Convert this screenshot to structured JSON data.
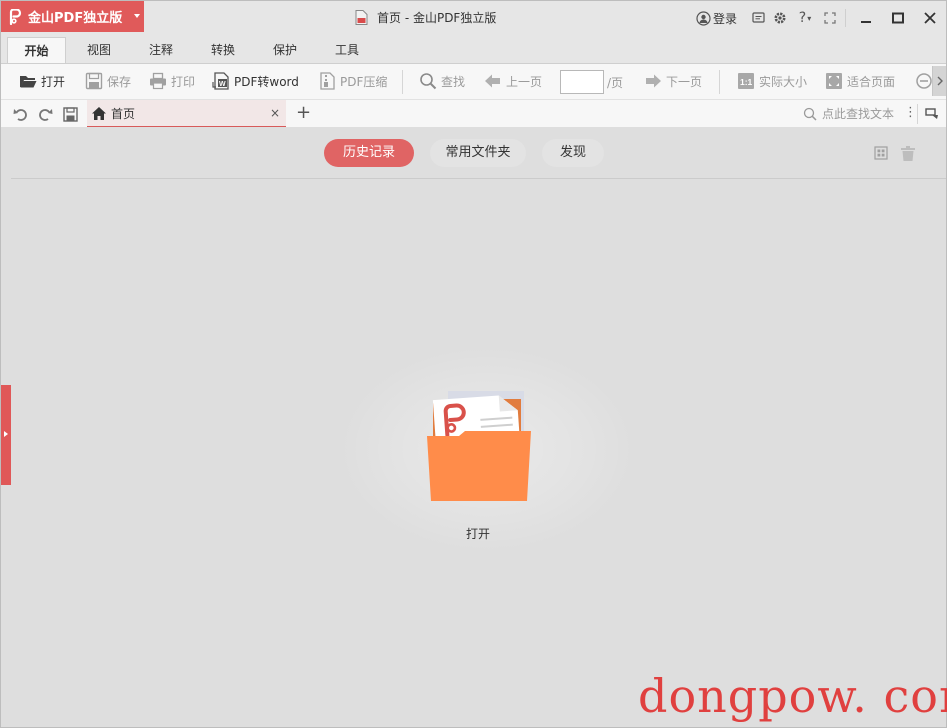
{
  "app": {
    "name": "金山PDF独立版",
    "window_title": "首页 - 金山PDF独立版",
    "brand_color": "#e05a5a"
  },
  "titlebar": {
    "login": "登录",
    "help": "?"
  },
  "ribbon_tabs": [
    "开始",
    "视图",
    "注释",
    "转换",
    "保护",
    "工具"
  ],
  "toolbar": {
    "open": "打开",
    "save": "保存",
    "print": "打印",
    "pdf_to_word": "PDF转word",
    "pdf_compress": "PDF压缩",
    "find": "查找",
    "prev_page": "上一页",
    "page_value": "",
    "page_suffix": "/页",
    "next_page": "下一页",
    "actual_size": "实际大小",
    "fit_page": "适合页面"
  },
  "doc_tabs": {
    "home": "首页",
    "close": "×",
    "add": "+",
    "search_placeholder": "点此查找文本",
    "more": "⋮"
  },
  "home": {
    "tabs": [
      "历史记录",
      "常用文件夹",
      "发现"
    ],
    "active_tab": "历史记录",
    "open_label": "打开"
  },
  "watermark": "dongpow. com"
}
